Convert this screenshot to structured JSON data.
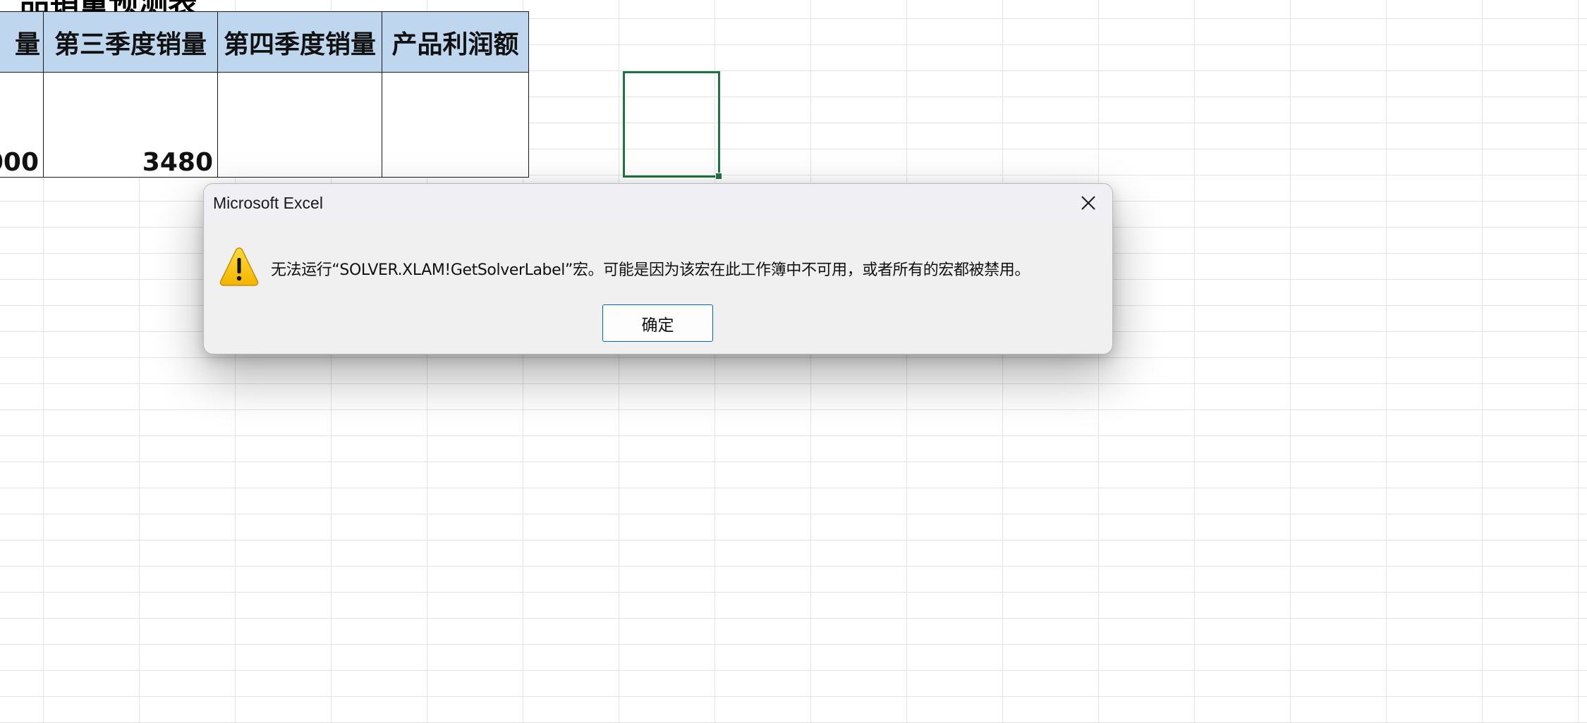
{
  "sheet": {
    "title": "品销量预测表",
    "headers": [
      "量",
      "第三季度销量",
      "第四季度销量",
      "产品利润额"
    ],
    "row1": [
      "000",
      "3480",
      "",
      ""
    ]
  },
  "dialog": {
    "title": "Microsoft Excel",
    "icon": "warning-icon",
    "message": "无法运行“SOLVER.XLAM!GetSolverLabel”宏。可能是因为该宏在此工作簿中不可用，或者所有的宏都被禁用。",
    "ok_label": "确定"
  },
  "colors": {
    "header_fill": "#bfd7ee",
    "selection": "#217346",
    "button_border": "#0067c0",
    "warning": "#f7c600"
  }
}
